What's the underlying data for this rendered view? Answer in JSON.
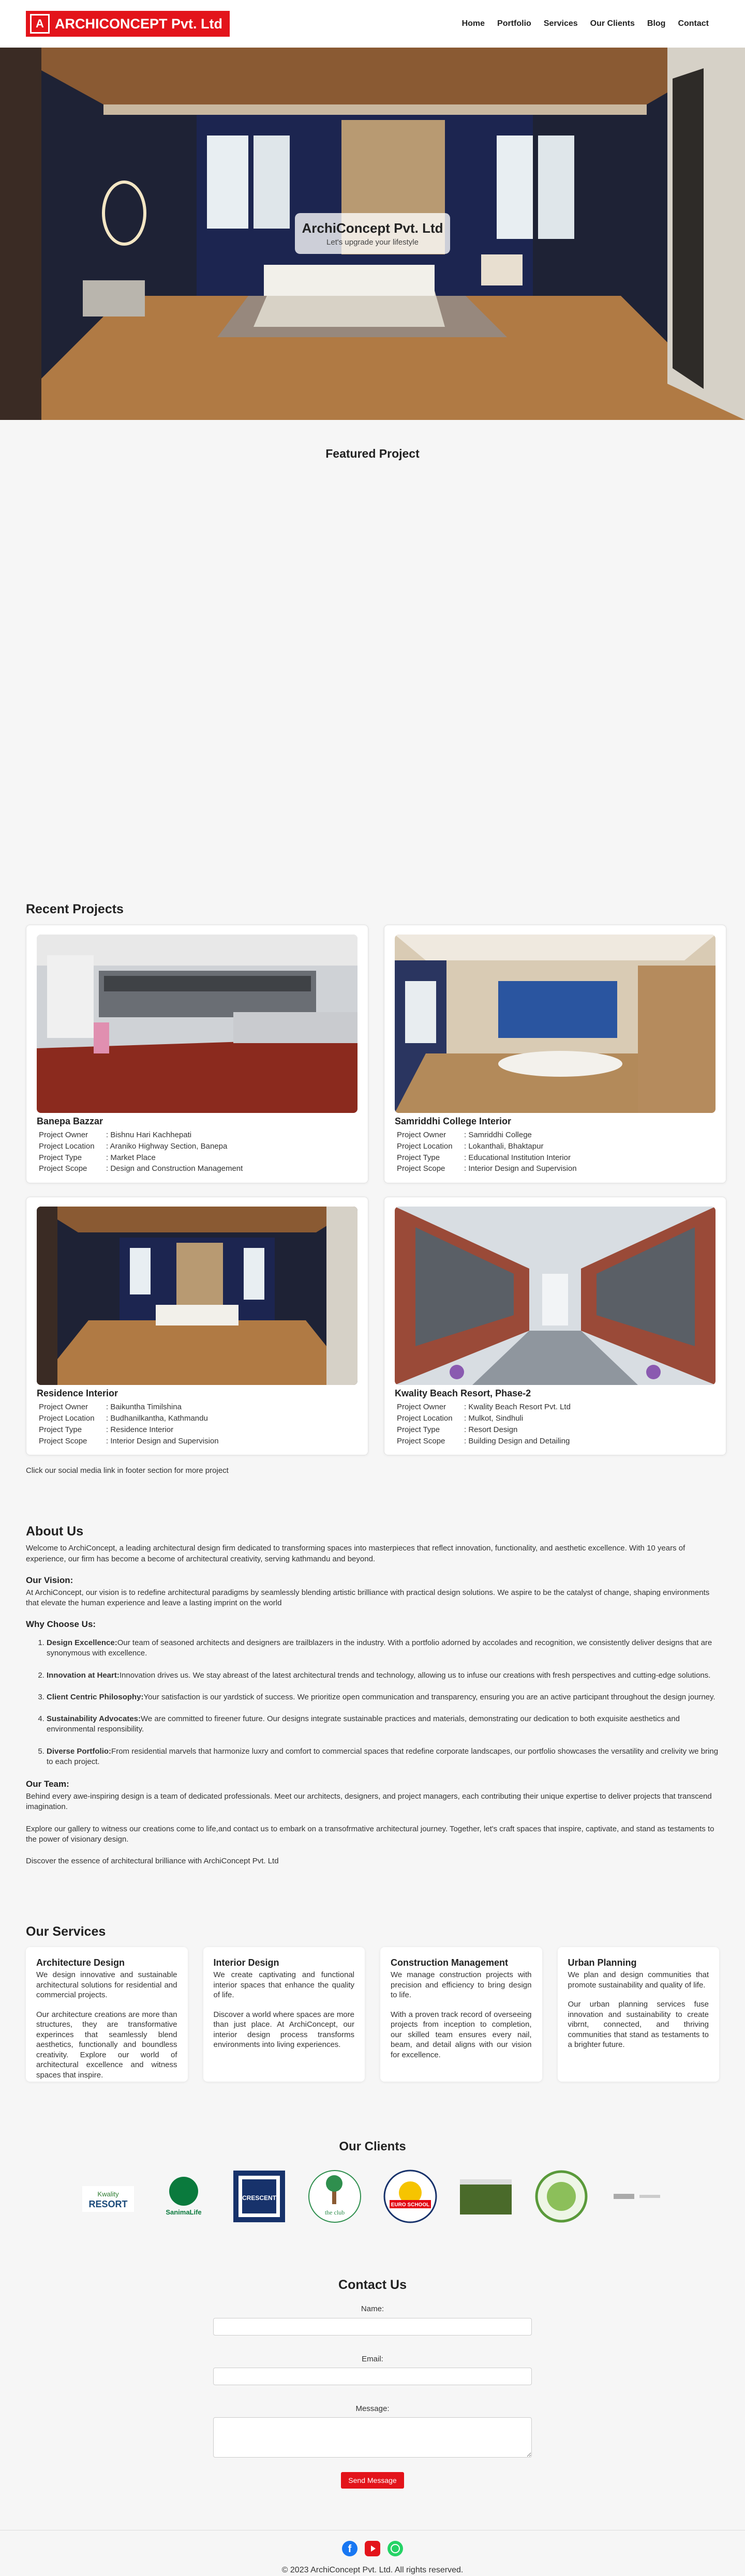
{
  "brand": {
    "name": "ARCHICONCEPT Pvt. Ltd",
    "mark": "A",
    "color": "#e3141b"
  },
  "nav": [
    "Home",
    "Portfolio",
    "Services",
    "Our Clients",
    "Blog",
    "Contact"
  ],
  "hero": {
    "title": "ArchiConcept Pvt. Ltd",
    "subtitle": "Let's upgrade your lifestyle"
  },
  "featured": {
    "heading": "Featured Project"
  },
  "recent": {
    "heading": "Recent Projects",
    "labels": [
      "Project Owner",
      "Project Location",
      "Project Type",
      "Project Scope"
    ],
    "projects": [
      {
        "name": "Banepa Bazzar",
        "owner": ": Bishnu Hari Kachhepati",
        "location": ": Araniko Highway Section, Banepa",
        "type": ": Market Place",
        "scope": ": Design and Construction Management"
      },
      {
        "name": "Samriddhi College Interior",
        "owner": ": Samriddhi College",
        "location": ": Lokanthali, Bhaktapur",
        "type": ": Educational Institution Interior",
        "scope": ": Interior Design and Supervision"
      },
      {
        "name": "Residence Interior",
        "owner": ": Baikuntha Timilshina",
        "location": ": Budhanilkantha, Kathmandu",
        "type": ": Residence Interior",
        "scope": ": Interior Design and Supervision"
      },
      {
        "name": "Kwality Beach Resort, Phase-2",
        "owner": ": Kwality Beach Resort Pvt. Ltd",
        "location": ": Mulkot, Sindhuli",
        "type": ": Resort Design",
        "scope": ": Building Design and Detailing"
      }
    ],
    "note": "Click our social media link in footer section for more project"
  },
  "about": {
    "heading": "About Us",
    "intro": "Welcome to ArchiConcept, a leading architectural design firm dedicated to transforming spaces into masterpieces that reflect innovation, functionality, and aesthetic excellence. With 10 years of experience, our firm has become a become of architectural creativity, serving kathmandu and beyond.",
    "vision_heading": "Our Vision:",
    "vision": "At ArchiConcept, our vision is to redefine architectural paradigms by seamlessly blending artistic brilliance with practical design solutions. We aspire to be the catalyst of change, shaping environments that elevate the human experience and leave a lasting imprint on the world",
    "why_heading": "Why Choose Us:",
    "reasons": [
      {
        "title": "Design Excellence:",
        "text": "Our team of seasoned architects and designers are trailblazers in the industry. With a portfolio adorned by accolades and recognition, we consistently deliver designs that are synonymous with excellence."
      },
      {
        "title": "Innovation at Heart:",
        "text": "Innovation drives us. We stay abreast of the latest architectural trends and technology, allowing us to infuse our creations with fresh perspectives and cutting-edge solutions."
      },
      {
        "title": "Client Centric Philosophy:",
        "text": "Your satisfaction is our yardstick of success. We prioritize open communication and transparency, ensuring you are an active participant throughout the design journey."
      },
      {
        "title": "Sustainability Advocates:",
        "text": "We are committed to fireener future. Our designs integrate sustainable practices and materials, demonstrating our dedication to both exquisite aesthetics and environmental responsibility."
      },
      {
        "title": "Diverse Portfolio:",
        "text": "From residential marvels that harmonize luxry and comfort to commercial spaces that redefine corporate landscapes, our portfolio showcases the versatility and crelivity we bring to each project."
      }
    ],
    "team_heading": "Our Team:",
    "team": "Behind every awe-inspiring design is a team of dedicated professionals. Meet our architects, designers, and project managers, each contributing their unique expertise to deliver projects that transcend imagination.",
    "explore": "Explore our gallery to witness our creations come to life,and contact us to embark on a transofrmative architectural journey. Together, let's craft spaces that inspire, captivate, and stand as testaments to the power of visionary design.",
    "discover": "Discover the essence of architectural brilliance with ArchiConcept Pvt. Ltd"
  },
  "services": {
    "heading": "Our Services",
    "items": [
      {
        "title": "Architecture Design",
        "p1": "We design innovative and sustainable architectural solutions for residential and commercial projects.",
        "p2": "Our architecture creations are more than structures, they are transformative experinces that seamlessly blend aesthetics, functionally and boundless creativity. Explore our world of architectural excellence and witness spaces that inspire."
      },
      {
        "title": "Interior Design",
        "p1": "We create captivating and functional interior spaces that enhance the quality of life.",
        "p2": "Discover a world where spaces are more than just place. At ArchiConcept, our interior design process transforms environments into living experiences."
      },
      {
        "title": "Construction Management",
        "p1": "We manage construction projects with precision and efficiency to bring design to life.",
        "p2": "With a proven track record of overseeing projects from inception to completion, our skilled team ensures every nail, beam, and detail aligns with our vision for excellence."
      },
      {
        "title": "Urban Planning",
        "p1": "We plan and design communities that promote sustainability and quality of life.",
        "p2": "Our urban planning services fuse innovation and sustainability to create vibrnt, connected, and thriving communities that stand as testaments to a brighter future."
      }
    ]
  },
  "clients": {
    "heading": "Our Clients",
    "logos": [
      {
        "name": "Kwality Beach Resort",
        "text": "RESORT",
        "color": "#2e7d32"
      },
      {
        "name": "SanimaLife Insurance",
        "text": "SanimaLife",
        "color": "#0a7a3d"
      },
      {
        "name": "Crescent",
        "text": "CRESCENT",
        "color": "#17326b"
      },
      {
        "name": "The Club",
        "text": "the club",
        "color": "#2f8f4e"
      },
      {
        "name": "Euro School",
        "text": "EURO SCHOOL",
        "color": "#e30613"
      },
      {
        "name": "Bhadgaun Club",
        "text": "",
        "color": "#4a6a2a"
      },
      {
        "name": "Seal",
        "text": "",
        "color": "#5a9a3a"
      },
      {
        "name": "Small Logo",
        "text": "",
        "color": "#888888"
      }
    ]
  },
  "contact": {
    "heading": "Contact Us",
    "name_label": "Name:",
    "email_label": "Email:",
    "message_label": "Message:",
    "button": "Send Message"
  },
  "footer": {
    "icons": [
      {
        "name": "facebook",
        "color": "#1877f2"
      },
      {
        "name": "youtube",
        "color": "#e3141b"
      },
      {
        "name": "whatsapp",
        "color": "#25d366"
      }
    ],
    "copyright": "© 2023 ArchiConcept Pvt. Ltd. All rights reserved."
  }
}
